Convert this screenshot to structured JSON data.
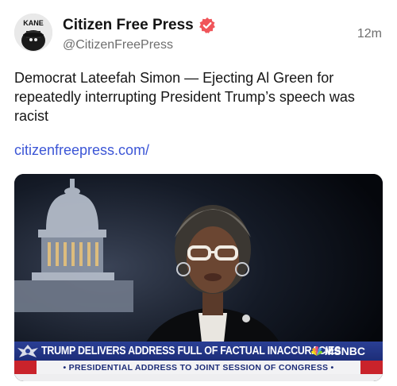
{
  "author": {
    "name": "Citizen Free Press",
    "handle": "@CitizenFreePress",
    "avatar_text": "KANE",
    "verified_color": "#f0555a"
  },
  "timestamp": "12m",
  "post": {
    "text": "Democrat Lateefah Simon — Ejecting Al Green for repeatedly interrupting President Trump’s speech was racist",
    "link": "citizenfreepress.com/"
  },
  "media": {
    "chyron_headline": "TRUMP DELIVERS ADDRESS FULL OF FACTUAL INACCURACIES",
    "network": "MSNBC",
    "subtitle": "• PRESIDENTIAL ADDRESS TO JOINT SESSION OF CONGRESS •"
  },
  "colors": {
    "link": "#3c56d6",
    "chyron": "#1d2d78",
    "accent_red": "#c9232b"
  }
}
